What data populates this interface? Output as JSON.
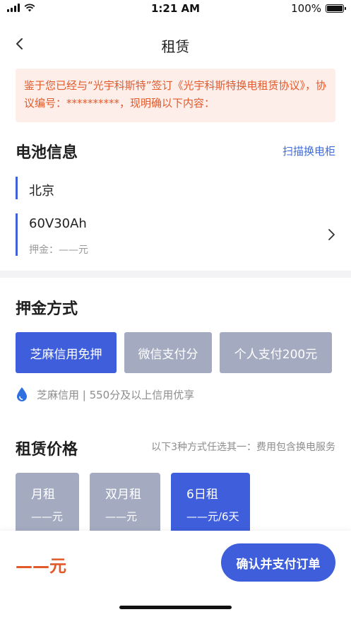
{
  "status_bar": {
    "time": "1:21 AM",
    "battery": "100%"
  },
  "nav": {
    "title": "租赁"
  },
  "notice": {
    "text": "鉴于您已经与“光宇科斯特”签订《光宇科斯特换电租赁协议》，协议编号：**********，现明确以下内容："
  },
  "battery_info": {
    "title": "电池信息",
    "scan_link": "扫描换电柜",
    "city": "北京",
    "model": "60V30Ah",
    "deposit": "押金：——元"
  },
  "deposit_method": {
    "title": "押金方式",
    "options": [
      {
        "label": "芝麻信用免押",
        "selected": true
      },
      {
        "label": "微信支付分",
        "selected": false
      },
      {
        "label": "个人支付200元",
        "selected": false
      }
    ],
    "note": "芝麻信用 | 550分及以上信用优享"
  },
  "rental_price": {
    "title": "租赁价格",
    "hint": "以下3种方式任选其一：费用包含换电服务",
    "plans": [
      {
        "name": "月租",
        "price": "——元",
        "selected": false
      },
      {
        "name": "双月租",
        "price": "——元",
        "selected": false
      },
      {
        "name": "6日租",
        "price": "——元/6天",
        "selected": true
      }
    ]
  },
  "footer": {
    "total": "——元",
    "pay_button": "确认并支付订单"
  },
  "colors": {
    "accent": "#3e5edc",
    "inactive": "#a4abc1",
    "warning": "#e25a2b",
    "notice_bg": "#fdeeea"
  },
  "icons": {
    "back": "chevron-left-icon",
    "more": "chevron-right-icon",
    "zhima": "water-drop-icon"
  }
}
